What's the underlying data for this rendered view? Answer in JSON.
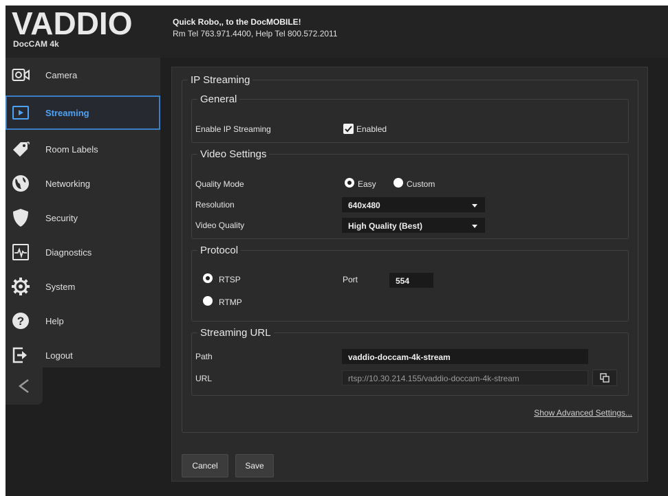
{
  "header": {
    "logo": "VADDIO",
    "model": "DocCAM 4k",
    "line1": "Quick Robo,, to the DocMOBILE!",
    "line2": "Rm Tel 763.971.4400, Help Tel 800.572.2011"
  },
  "sidebar": {
    "items": [
      {
        "label": "Camera",
        "icon": "camera-icon"
      },
      {
        "label": "Streaming",
        "icon": "play-icon",
        "active": true
      },
      {
        "label": "Room Labels",
        "icon": "tag-icon"
      },
      {
        "label": "Networking",
        "icon": "globe-icon"
      },
      {
        "label": "Security",
        "icon": "shield-icon"
      },
      {
        "label": "Diagnostics",
        "icon": "pulse-icon"
      },
      {
        "label": "System",
        "icon": "gear-icon"
      },
      {
        "label": "Help",
        "icon": "help-icon"
      },
      {
        "label": "Logout",
        "icon": "logout-icon"
      }
    ],
    "collapse": "<"
  },
  "main": {
    "title": "IP Streaming",
    "general": {
      "legend": "General",
      "enable_label": "Enable IP Streaming",
      "enabled_text": "Enabled",
      "enabled": true
    },
    "video": {
      "legend": "Video Settings",
      "quality_mode_label": "Quality Mode",
      "mode_easy": "Easy",
      "mode_custom": "Custom",
      "mode_selected": "Easy",
      "resolution_label": "Resolution",
      "resolution_value": "640x480",
      "quality_label": "Video Quality",
      "quality_value": "High Quality (Best)"
    },
    "protocol": {
      "legend": "Protocol",
      "rtsp": "RTSP",
      "rtmp": "RTMP",
      "selected": "RTSP",
      "port_label": "Port",
      "port_value": "554"
    },
    "url": {
      "legend": "Streaming URL",
      "path_label": "Path",
      "path_value": "vaddio-doccam-4k-stream",
      "url_label": "URL",
      "url_value": "rtsp://10.30.214.155/vaddio-doccam-4k-stream"
    },
    "advanced_link": "Show Advanced Settings...",
    "cancel": "Cancel",
    "save": "Save"
  },
  "colors": {
    "accent": "#3a7ec6",
    "active_text": "#4ea2f5",
    "background": "#1f1f1f",
    "panel": "#2b2b2b"
  }
}
